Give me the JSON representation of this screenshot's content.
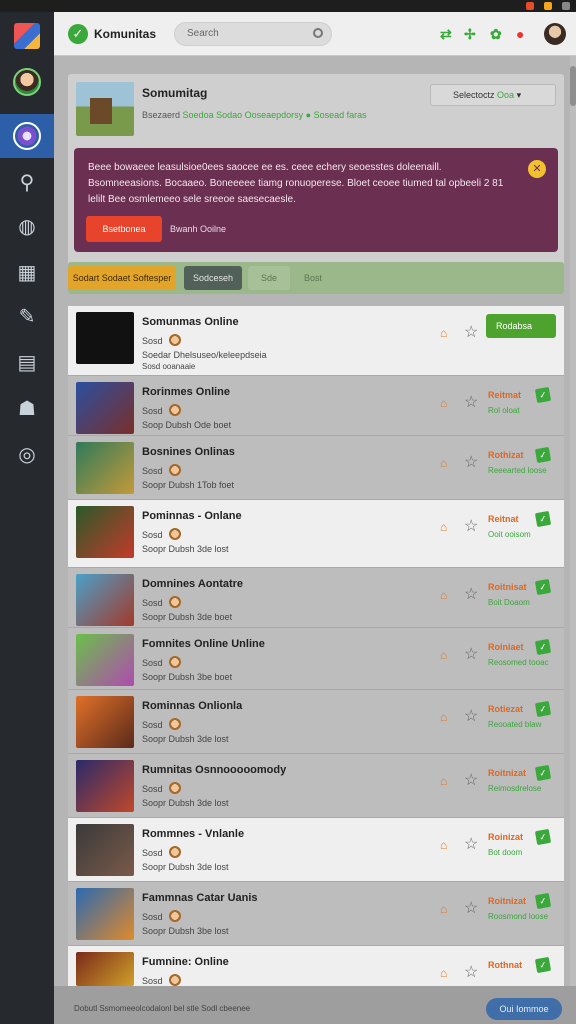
{
  "app": {
    "title": "Komunitas",
    "search_placeholder": "Search"
  },
  "colors": {
    "accent": "#2d5fa8",
    "success": "#3aa83a",
    "alert_bg": "#6b2f52",
    "danger": "#e8432b",
    "warning": "#e3a42a"
  },
  "community": {
    "name": "Somumitag",
    "meta_left": "Bsezaerd",
    "meta_green": "Soedoa Sodao Ooseaepdorsy",
    "meta_right": "Sosead faras",
    "select_label": "Selectoctz",
    "select_value": "Ooa"
  },
  "alert": {
    "text": "Beee bowaeee leasulsioe0ees saocee ee es. ceee echery seoesstes doleenaill. Bsomneeasions. Bocaaeo. Boneeeee tiamg ronuoperese. Bloet ceoee tiumed tal opbeeli 2 81 lelilt Bee osmlemeeo sele sreeoe saesecaesle.",
    "primary_button": "Bsetbonea",
    "secondary_link": "Bwanh Ooilne"
  },
  "filters": [
    "Sodart Sodaet Softesper",
    "Sodceseh",
    "Sde",
    "Bost"
  ],
  "games": [
    {
      "title": "Somunmas Online",
      "sub": "Sosd",
      "meta": "Soedar Dhelsuseo/keleepdseia",
      "meta2": "Sosd ooanaaie",
      "status": "",
      "status2": "",
      "button": "Rodabsa"
    },
    {
      "title": "Rorinmes Online",
      "sub": "Sosd",
      "meta": "Soop Dubsh Ode boet",
      "status": "Reitmat",
      "status2": "Rol oloat"
    },
    {
      "title": "Bosnines Onlinas",
      "sub": "Sosd",
      "meta": "Soopr Dubsh 1Tob foet",
      "status": "Rothizat",
      "status2": "Reeearted loose"
    },
    {
      "title": "Pominnas - Onlane",
      "sub": "Sosd",
      "meta": "Soopr Dubsh 3de lost",
      "status": "Reitnat",
      "status2": "Ooit ooisom"
    },
    {
      "title": "Domnines Aontatre",
      "sub": "Sosd",
      "meta": "Soopr Dubsh 3de boet",
      "status": "Roitnisat",
      "status2": "Boit Doaom"
    },
    {
      "title": "Fomnites Online Unline",
      "sub": "Sosd",
      "meta": "Soopr Dubsh 3be boet",
      "status": "Roiniaet",
      "status2": "Reosomed tooac"
    },
    {
      "title": "Rominnas Onlionla",
      "sub": "Sosd",
      "meta": "Soopr Dubsh 3de lost",
      "status": "Rotiezat",
      "status2": "Reooated blaw"
    },
    {
      "title": "Rumnitas Osnnooooomody",
      "sub": "Sosd",
      "meta": "Soopr Dubsh 3de lost",
      "status": "Roitnizat",
      "status2": "Reimosdrelose"
    },
    {
      "title": "Rommnes - Vnlanle",
      "sub": "Sosd",
      "meta": "Soopr Dubsh 3de lost",
      "status": "Roinizat",
      "status2": "Bot doom"
    },
    {
      "title": "Fammnas Catar Uanis",
      "sub": "Sosd",
      "meta": "Soopr Dubsh 3be lost",
      "status": "Roitnizat",
      "status2": "Roosmond loose"
    },
    {
      "title": "Fumnine: Online",
      "sub": "Sosd",
      "meta": "",
      "status": "Rothnat",
      "status2": ""
    }
  ],
  "footer": {
    "text": "Dobutl Ssmomeeolcodalonl bel stle Sodl cbeenee",
    "button": "Oui Iommoe"
  }
}
